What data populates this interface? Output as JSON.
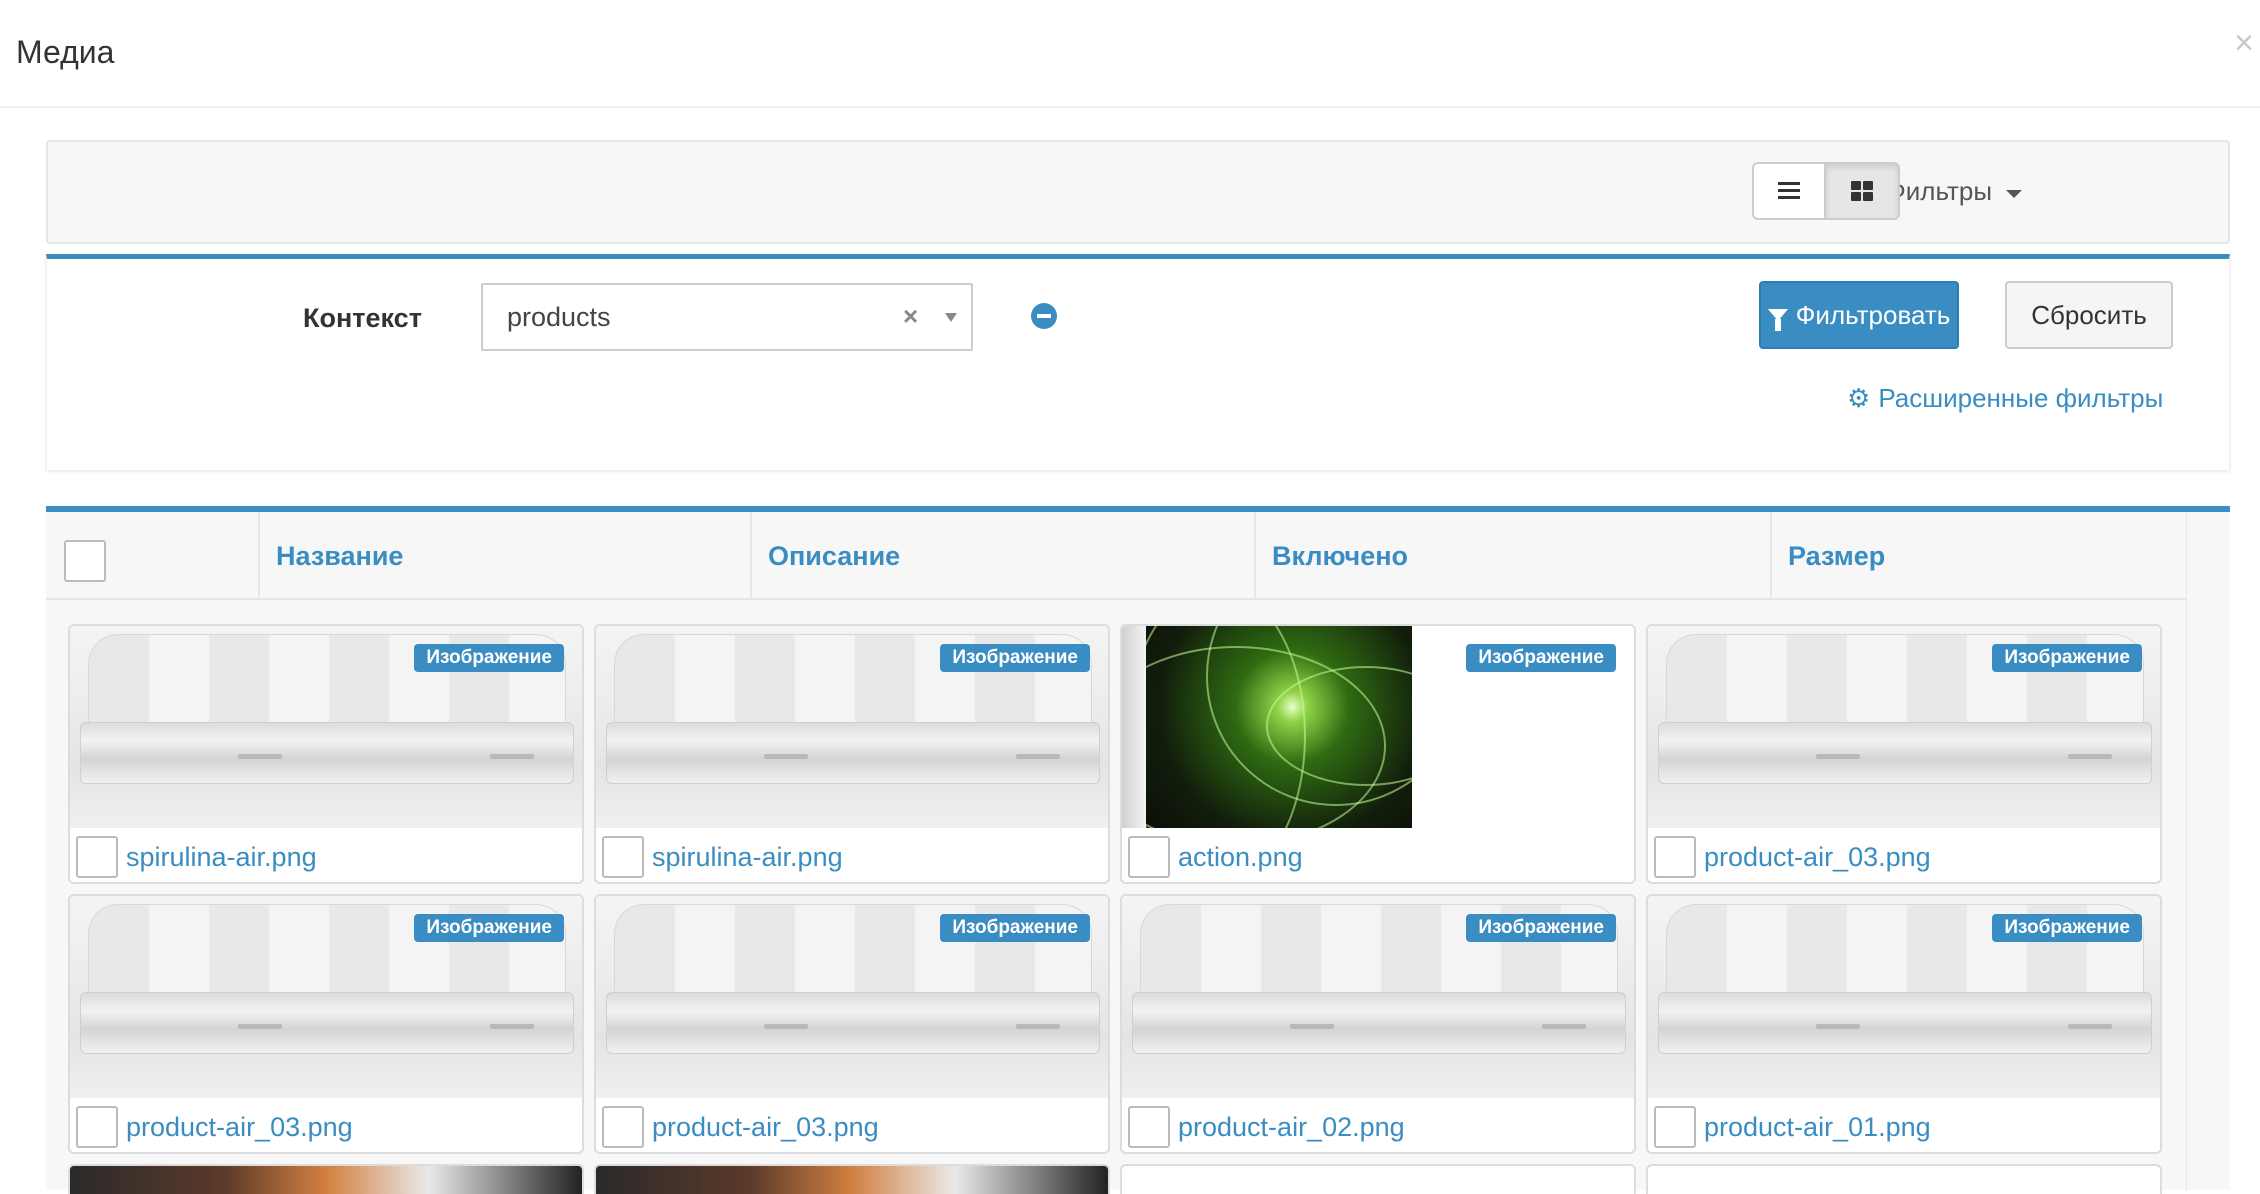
{
  "modal": {
    "title": "Медиа",
    "close": "×"
  },
  "toolbar": {
    "filters_label": "Фильтры"
  },
  "filter": {
    "context_label": "Контекст",
    "context_value": "products",
    "clear_symbol": "×",
    "filter_button": "Фильтровать",
    "reset_button": "Сбросить",
    "advanced_link": "Расширенные фильтры"
  },
  "table": {
    "columns": [
      "Название",
      "Описание",
      "Включено",
      "Размер"
    ]
  },
  "cards": [
    {
      "name": "spirulina-air.png",
      "badge": "Изображение",
      "thumb": "jar"
    },
    {
      "name": "spirulina-air.png",
      "badge": "Изображение",
      "thumb": "jar"
    },
    {
      "name": "action.png",
      "badge": "Изображение",
      "thumb": "action"
    },
    {
      "name": "product-air_03.png",
      "badge": "Изображение",
      "thumb": "jar"
    },
    {
      "name": "product-air_03.png",
      "badge": "Изображение",
      "thumb": "jar"
    },
    {
      "name": "product-air_03.png",
      "badge": "Изображение",
      "thumb": "jar"
    },
    {
      "name": "product-air_02.png",
      "badge": "Изображение",
      "thumb": "jar"
    },
    {
      "name": "product-air_01.png",
      "badge": "Изображение",
      "thumb": "jar"
    }
  ],
  "colors": {
    "accent": "#3a8dc2",
    "panel_bg": "#f7f7f7"
  },
  "icons": [
    "close-icon",
    "filter-icon",
    "caret-down-icon",
    "list-view-icon",
    "grid-view-icon",
    "remove-icon",
    "gears-icon"
  ]
}
